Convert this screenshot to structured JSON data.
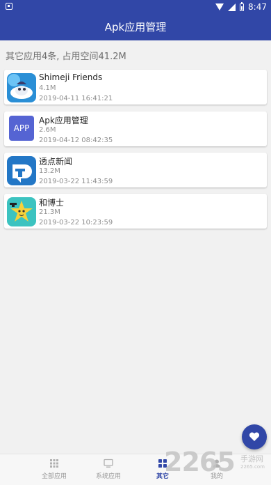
{
  "status_bar": {
    "time": "8:47"
  },
  "title": "Apk应用管理",
  "summary": "其它应用4条, 占用空间41.2M",
  "apps": [
    {
      "name": "Shimeji Friends",
      "size": "4.1M",
      "date": "2019-04-11 16:41:21",
      "icon": "shimeji-friends-icon"
    },
    {
      "name": "Apk应用管理",
      "size": "2.6M",
      "date": "2019-04-12 08:42:35",
      "icon": "apk-manager-icon",
      "icon_text": "APP"
    },
    {
      "name": "透点新闻",
      "size": "13.2M",
      "date": "2019-03-22 11:43:59",
      "icon": "toudian-news-icon"
    },
    {
      "name": "和博士",
      "size": "21.3M",
      "date": "2019-03-22 10:23:59",
      "icon": "hebo-shi-icon"
    }
  ],
  "bottom_nav": [
    {
      "label": "全部应用",
      "icon": "grid-icon",
      "active": false
    },
    {
      "label": "系统应用",
      "icon": "monitor-icon",
      "active": false
    },
    {
      "label": "其它",
      "icon": "tiles-icon",
      "active": true
    },
    {
      "label": "我的",
      "icon": "user-icon",
      "active": false
    }
  ],
  "fab": {
    "icon": "heart-icon"
  },
  "watermark": {
    "text": "2265",
    "suffix": "手游网",
    "url": "2265.com"
  },
  "colors": {
    "primary": "#3147a7",
    "background": "#f1f1f1",
    "card": "#ffffff"
  }
}
